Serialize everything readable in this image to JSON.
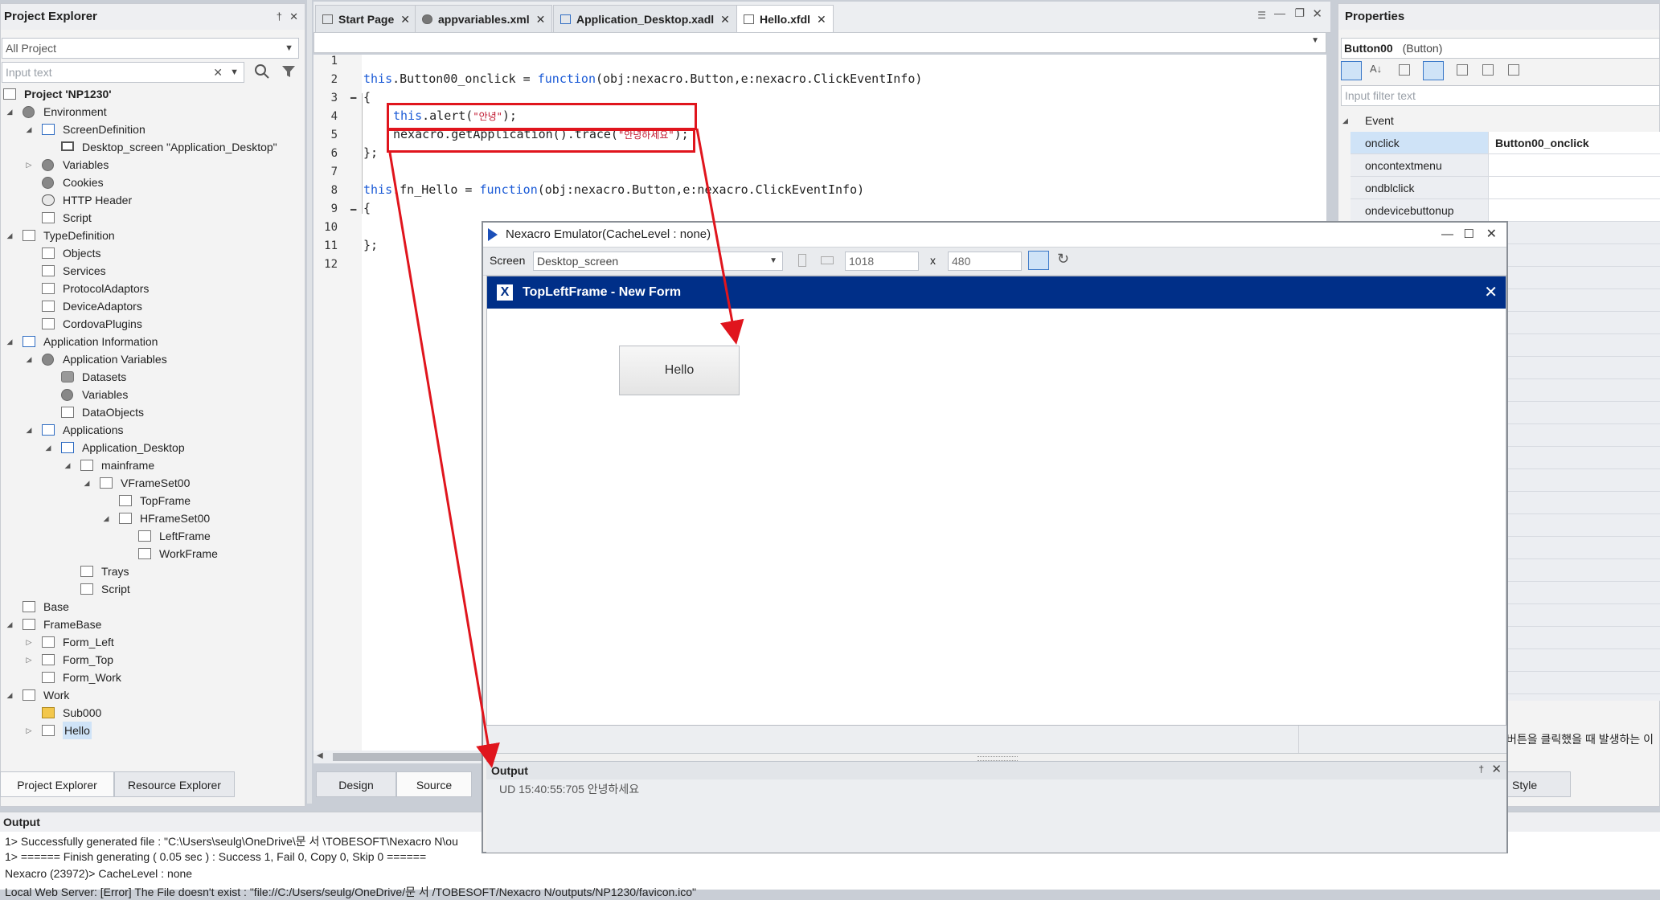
{
  "project_explorer": {
    "title": "Project Explorer",
    "pin": "†",
    "close": "✕",
    "filter_value": "All Project",
    "search_placeholder": "Input text",
    "tree": [
      {
        "label": "Project 'NP1230'",
        "bold": true
      },
      {
        "label": "Environment"
      },
      {
        "label": "ScreenDefinition"
      },
      {
        "label": "Desktop_screen \"Application_Desktop\""
      },
      {
        "label": "Variables"
      },
      {
        "label": "Cookies"
      },
      {
        "label": "HTTP Header"
      },
      {
        "label": "Script"
      },
      {
        "label": "TypeDefinition"
      },
      {
        "label": "Objects"
      },
      {
        "label": "Services"
      },
      {
        "label": "ProtocolAdaptors"
      },
      {
        "label": "DeviceAdaptors"
      },
      {
        "label": "CordovaPlugins"
      },
      {
        "label": "Application Information"
      },
      {
        "label": "Application Variables"
      },
      {
        "label": "Datasets"
      },
      {
        "label": "Variables"
      },
      {
        "label": "DataObjects"
      },
      {
        "label": "Applications"
      },
      {
        "label": "Application_Desktop"
      },
      {
        "label": "mainframe"
      },
      {
        "label": "VFrameSet00"
      },
      {
        "label": "TopFrame"
      },
      {
        "label": "HFrameSet00"
      },
      {
        "label": "LeftFrame"
      },
      {
        "label": "WorkFrame"
      },
      {
        "label": "Trays"
      },
      {
        "label": "Script"
      },
      {
        "label": "Base"
      },
      {
        "label": "FrameBase"
      },
      {
        "label": "Form_Left"
      },
      {
        "label": "Form_Top"
      },
      {
        "label": "Form_Work"
      },
      {
        "label": "Work"
      },
      {
        "label": "Sub000"
      },
      {
        "label": "Hello",
        "selected": true
      }
    ],
    "tabs": [
      "Project Explorer",
      "Resource Explorer"
    ]
  },
  "editor": {
    "tabs": [
      {
        "label": "Start Page"
      },
      {
        "label": "appvariables.xml"
      },
      {
        "label": "Application_Desktop.xadl"
      },
      {
        "label": "Hello.xfdl",
        "active": true
      }
    ],
    "tab_close": "✕",
    "line_numbers": [
      "1",
      "2",
      "3",
      "4",
      "5",
      "6",
      "7",
      "8",
      "9",
      "10",
      "11",
      "12"
    ],
    "code": {
      "l2_this": "this",
      "l2_mid": ".Button00_onclick = ",
      "l2_fn": "function",
      "l2_tail": "(obj:nexacro.Button,e:nexacro.ClickEventInfo)",
      "l3": "{",
      "l4_this": "this",
      "l4_mid": ".alert(",
      "l4_str": "\"안녕\"",
      "l4_tail": ");",
      "l5_a": "nexacro.getApplication().trace(",
      "l5_str": "\"안녕하세요\"",
      "l5_tail": ");",
      "l6": "};",
      "l8_this": "this",
      "l8_mid": ".fn_Hello = ",
      "l8_fn": "function",
      "l8_tail": "(obj:nexacro.Button,e:nexacro.ClickEventInfo)",
      "l9": "{",
      "l11": "};"
    },
    "bottom_tabs": [
      "Design",
      "Source"
    ]
  },
  "properties": {
    "title": "Properties",
    "object": "Button00",
    "object_type": "(Button)",
    "filter_placeholder": "Input filter text",
    "category": "Event",
    "rows": [
      {
        "name": "onclick",
        "value": "Button00_onclick",
        "selected": true
      },
      {
        "name": "oncontextmenu",
        "value": ""
      },
      {
        "name": "ondblclick",
        "value": ""
      },
      {
        "name": "ondevicebuttonup",
        "value": ""
      }
    ],
    "description": "버튼을 클릭했을 때 발생하는 이",
    "style_tab": "Style"
  },
  "emulator": {
    "title": "Nexacro Emulator(CacheLevel : none)",
    "screen_label": "Screen",
    "screen_value": "Desktop_screen",
    "width": "1018",
    "x_label": "x",
    "height": "480",
    "frame_title": "TopLeftFrame - New Form",
    "button_label": "Hello",
    "output_title": "Output",
    "output_line": "UD 15:40:55:705 안녕하세요"
  },
  "output": {
    "title": "Output",
    "lines": [
      "1> Successfully generated file : \"C:\\Users\\seulg\\OneDrive\\문 서 \\TOBESOFT\\Nexacro N\\ou",
      "1> ====== Finish generating ( 0.05 sec ) : Success 1, Fail 0, Copy 0, Skip 0 ======",
      "Nexacro (23972)> CacheLevel : none",
      "Local Web Server: [Error] The File doesn't exist : \"file://C:/Users/seulg/OneDrive/문 서 /TOBESOFT/Nexacro N/outputs/NP1230/favicon.ico\""
    ]
  },
  "colors": {
    "accent": "#002f88",
    "annotation": "#e0151d",
    "keyword": "#1a5ad6",
    "string": "#c0142c"
  }
}
